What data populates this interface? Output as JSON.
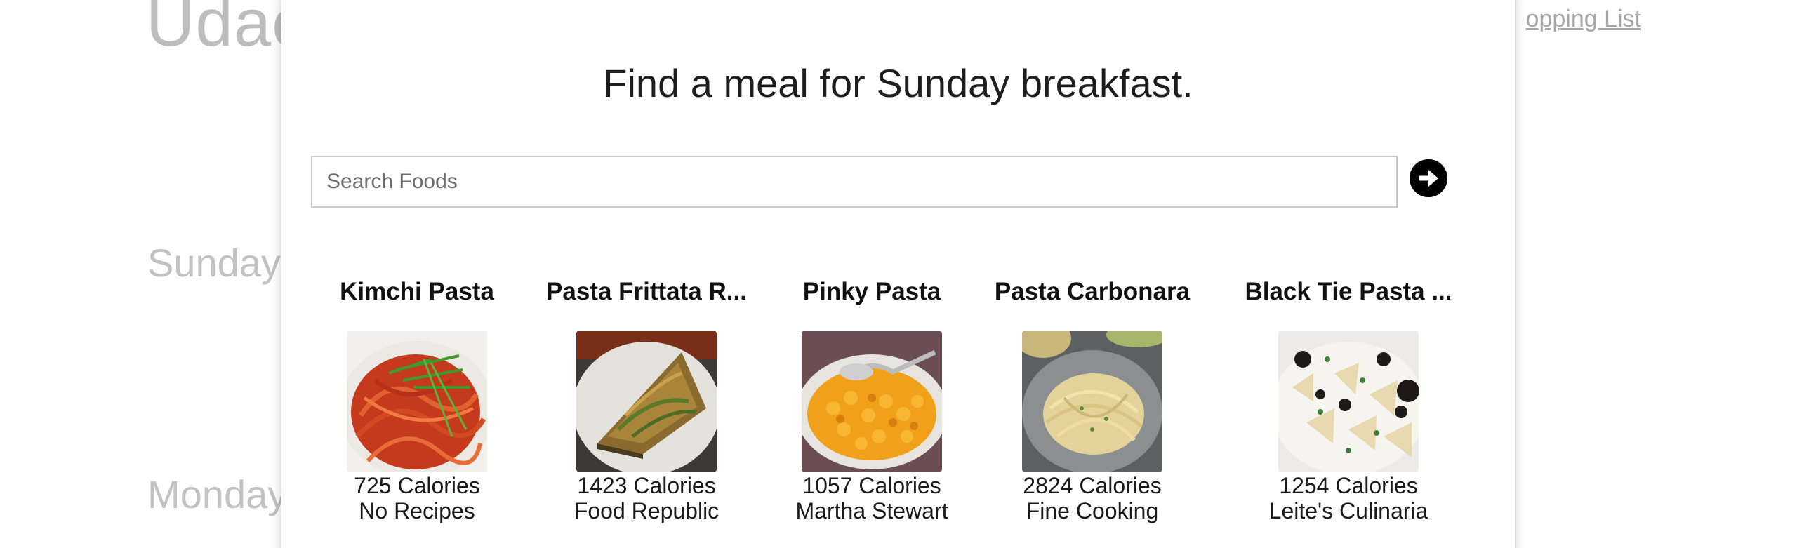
{
  "background": {
    "logo_text": "Udac",
    "shopping_list_link": "opping List",
    "days": [
      "Sunday",
      "Monday"
    ]
  },
  "modal": {
    "title": "Find a meal for Sunday breakfast.",
    "search": {
      "placeholder": "Search Foods",
      "value": "",
      "submit_icon": "arrow-right-circle-icon"
    },
    "results": [
      {
        "name": "Kimchi Pasta",
        "calories": "725 Calories",
        "source": "No Recipes",
        "image": "red-spaghetti-with-scallions-photo"
      },
      {
        "name": "Pasta Frittata R...",
        "calories": "1423 Calories",
        "source": "Food Republic",
        "image": "pasta-frittata-slice-photo"
      },
      {
        "name": "Pinky Pasta",
        "calories": "1057 Calories",
        "source": "Martha Stewart",
        "image": "macaroni-bowl-photo"
      },
      {
        "name": "Pasta Carbonara",
        "calories": "2824 Calories",
        "source": "Fine Cooking",
        "image": "spaghetti-carbonara-plate-photo"
      },
      {
        "name": "Black Tie Pasta ...",
        "calories": "1254 Calories",
        "source": "Leite's Culinaria",
        "image": "farfalle-cream-pasta-photo"
      }
    ]
  },
  "colors": {
    "overlay_text": "#c2c2c2",
    "modal_background": "#ffffff",
    "search_border": "#c9c9c9",
    "submit_button": "#000000"
  }
}
